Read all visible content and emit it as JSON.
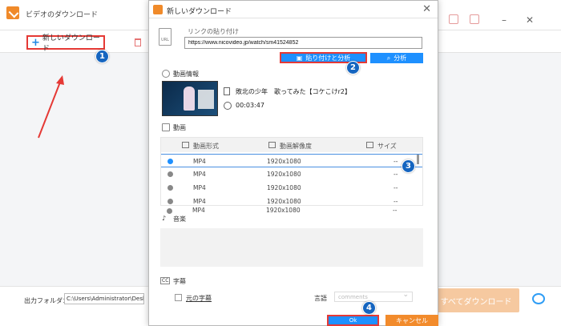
{
  "main_window": {
    "title": "ビデオのダウンロード",
    "new_download_label": "新しいダウンロード",
    "output_folder_label": "出力フォルダ：",
    "output_folder_value": "C:\\Users\\Administrator\\Desktop",
    "download_all_label": "すべてダウンロード"
  },
  "dialog": {
    "title": "新しいダウンロード",
    "url_section_label": "リンクの貼り付け",
    "url_doc_icon_text": "URL",
    "url_value": "https://www.nicovideo.jp/watch/sm41524852",
    "paste_analyze_label": "貼り付けと分析",
    "analyze_label": "分析",
    "video_info_label": "動画情報",
    "video_title": "敗北の少年　歌ってみた【コケこけr2】",
    "duration": "00:03:47",
    "video_section_label": "動画",
    "table_headers": {
      "format": "動画形式",
      "resolution": "動画解像度",
      "size": "サイズ"
    },
    "rows": [
      {
        "format": "MP4",
        "resolution": "1920x1080",
        "size": "--",
        "selected": true
      },
      {
        "format": "MP4",
        "resolution": "1920x1080",
        "size": "--",
        "selected": false
      },
      {
        "format": "MP4",
        "resolution": "1920x1080",
        "size": "--",
        "selected": false
      },
      {
        "format": "MP4",
        "resolution": "1920x1080",
        "size": "--",
        "selected": false
      },
      {
        "format": "MP4",
        "resolution": "1920x1080",
        "size": "--",
        "selected": false
      }
    ],
    "music_section_label": "音楽",
    "subtitle_section_label": "字幕",
    "original_subtitle_label": "元の字幕",
    "language_label": "言語",
    "language_value": "comments",
    "ok_label": "Ok",
    "cancel_label": "キャンセル"
  },
  "step_badges": [
    "1",
    "2",
    "3",
    "4"
  ],
  "colors": {
    "accent_blue": "#1e90ff",
    "highlight_red": "#e53935",
    "cancel_orange": "#f28b2c",
    "badge_blue": "#1565c0",
    "app_orange": "#f08a2a"
  },
  "icons": [
    "app-logo-icon",
    "plus-icon",
    "trash-icon",
    "url-doc-icon",
    "clipboard-icon",
    "search-icon",
    "info-icon",
    "video-icon",
    "clock-icon",
    "film-icon",
    "resolution-icon",
    "folder-icon",
    "music-icon",
    "subtitle-icon",
    "alarm-icon",
    "close-icon"
  ]
}
